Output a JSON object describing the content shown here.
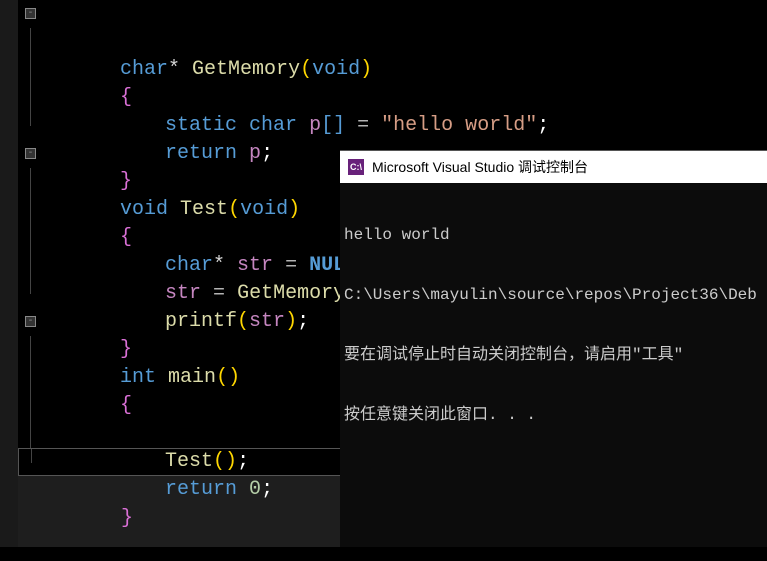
{
  "code": {
    "line1": {
      "kw1": "char",
      "star": "* ",
      "fn": "GetMemory",
      "lp": "(",
      "kw2": "void",
      "rp": ")"
    },
    "line2": {
      "brace": "{"
    },
    "line3": {
      "kw1": "static",
      "sp1": " ",
      "kw2": "char",
      "sp2": " ",
      "var": "p",
      "lb": "[",
      "rb": "]",
      "sp3": " ",
      "eq": "=",
      "sp4": " ",
      "str": "\"hello world\"",
      "semi": ";"
    },
    "line4": {
      "kw": "return",
      "sp": " ",
      "var": "p",
      "semi": ";"
    },
    "line5": {
      "brace": "}"
    },
    "line6": {
      "kw1": "void",
      "sp": " ",
      "fn": "Test",
      "lp": "(",
      "kw2": "void",
      "rp": ")"
    },
    "line7": {
      "brace": "{"
    },
    "line8": {
      "kw": "char",
      "star": "* ",
      "var": "str",
      "sp": " ",
      "eq": "=",
      "sp2": " ",
      "null": "NULL",
      "semi": ";"
    },
    "line9": {
      "var": "str",
      "sp": " ",
      "eq": "=",
      "sp2": " ",
      "fn": "GetMemory",
      "lp": "(",
      "rp": ")",
      "semi": ";"
    },
    "line10": {
      "fn": "printf",
      "lp": "(",
      "var": "str",
      "rp": ")",
      "semi": ";"
    },
    "line11": {
      "brace": "}"
    },
    "line12": {
      "kw": "int",
      "sp": " ",
      "fn": "main",
      "lp": "(",
      "rp": ")"
    },
    "line13": {
      "brace": "{"
    },
    "line14": {
      "empty": ""
    },
    "line15": {
      "fn": "Test",
      "lp": "(",
      "rp": ")",
      "semi": ";"
    },
    "line16": {
      "kw": "return",
      "sp": " ",
      "num": "0",
      "semi": ";"
    },
    "line17": {
      "brace": "}"
    },
    "outline_minus": "-"
  },
  "console": {
    "title": "Microsoft Visual Studio 调试控制台",
    "icon_text": "C:\\",
    "output_line1": "hello world",
    "output_line2": "C:\\Users\\mayulin\\source\\repos\\Project36\\Deb",
    "output_line3": "要在调试停止时自动关闭控制台，请启用\"工具\"",
    "output_line4": "按任意键关闭此窗口. . ."
  }
}
